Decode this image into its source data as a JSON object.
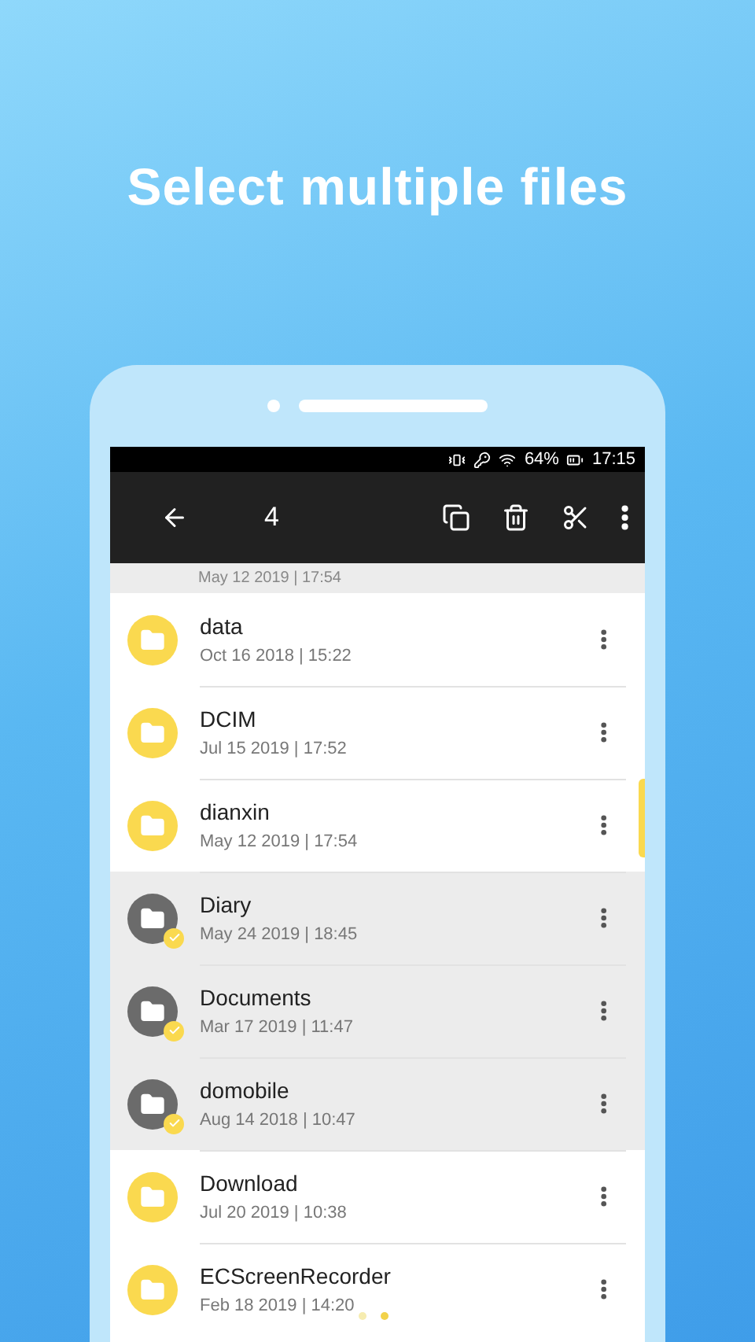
{
  "headline": "Select multiple files",
  "status_bar": {
    "battery": "64%",
    "time": "17:15"
  },
  "toolbar": {
    "count": "4"
  },
  "partial_row": {
    "date": "May 12 2019 | 17:54",
    "selected": true
  },
  "files": [
    {
      "name": "data",
      "date": "Oct 16 2018 | 15:22",
      "selected": false
    },
    {
      "name": "DCIM",
      "date": "Jul 15 2019 | 17:52",
      "selected": false
    },
    {
      "name": "dianxin",
      "date": "May 12 2019 | 17:54",
      "selected": false
    },
    {
      "name": "Diary",
      "date": "May 24 2019 | 18:45",
      "selected": true
    },
    {
      "name": "Documents",
      "date": "Mar 17 2019 | 11:47",
      "selected": true
    },
    {
      "name": "domobile",
      "date": "Aug 14 2018 | 10:47",
      "selected": true
    },
    {
      "name": "Download",
      "date": "Jul 20 2019 | 10:38",
      "selected": false
    },
    {
      "name": "ECScreenRecorder",
      "date": "Feb 18 2019 | 14:20",
      "selected": false
    }
  ]
}
